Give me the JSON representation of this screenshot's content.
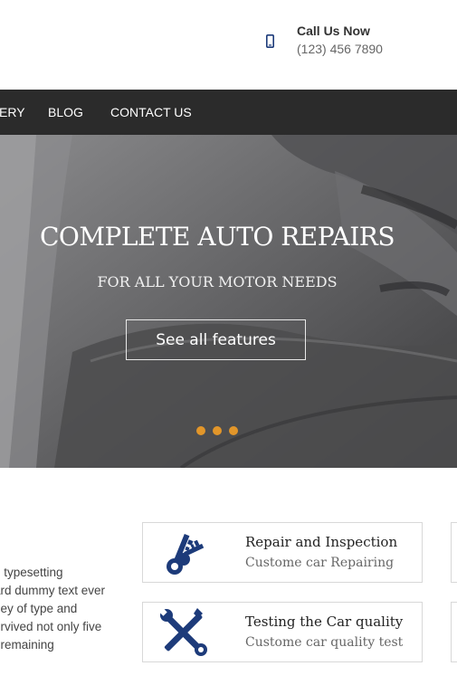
{
  "header": {
    "call_title": "Call Us Now",
    "call_number": "(123) 456 7890",
    "phone_icon": "mobile-phone-icon"
  },
  "nav": {
    "items": [
      {
        "label": "ERY"
      },
      {
        "label": "BLOG"
      },
      {
        "label": "CONTACT US"
      }
    ]
  },
  "hero": {
    "title": "COMPLETE AUTO REPAIRS",
    "subtitle": "FOR ALL YOUR MOTOR NEEDS",
    "button_label": "See all features",
    "slide_count": 3,
    "accent_color": "#e2962a"
  },
  "about": {
    "lines": [
      "g typesetting",
      "ard dummy text ever",
      "ney of type and",
      "urvived not only five",
      ", remaining"
    ]
  },
  "features": [
    {
      "title": "Repair and Inspection",
      "subtitle": "Custome car Repairing",
      "icon": "keys-icon"
    },
    {
      "title": "Testing the Car quality",
      "subtitle": "Custome car quality test",
      "icon": "tools-icon"
    }
  ],
  "colors": {
    "nav_bg": "#2b2b2b",
    "icon_blue": "#1d3b7a"
  }
}
